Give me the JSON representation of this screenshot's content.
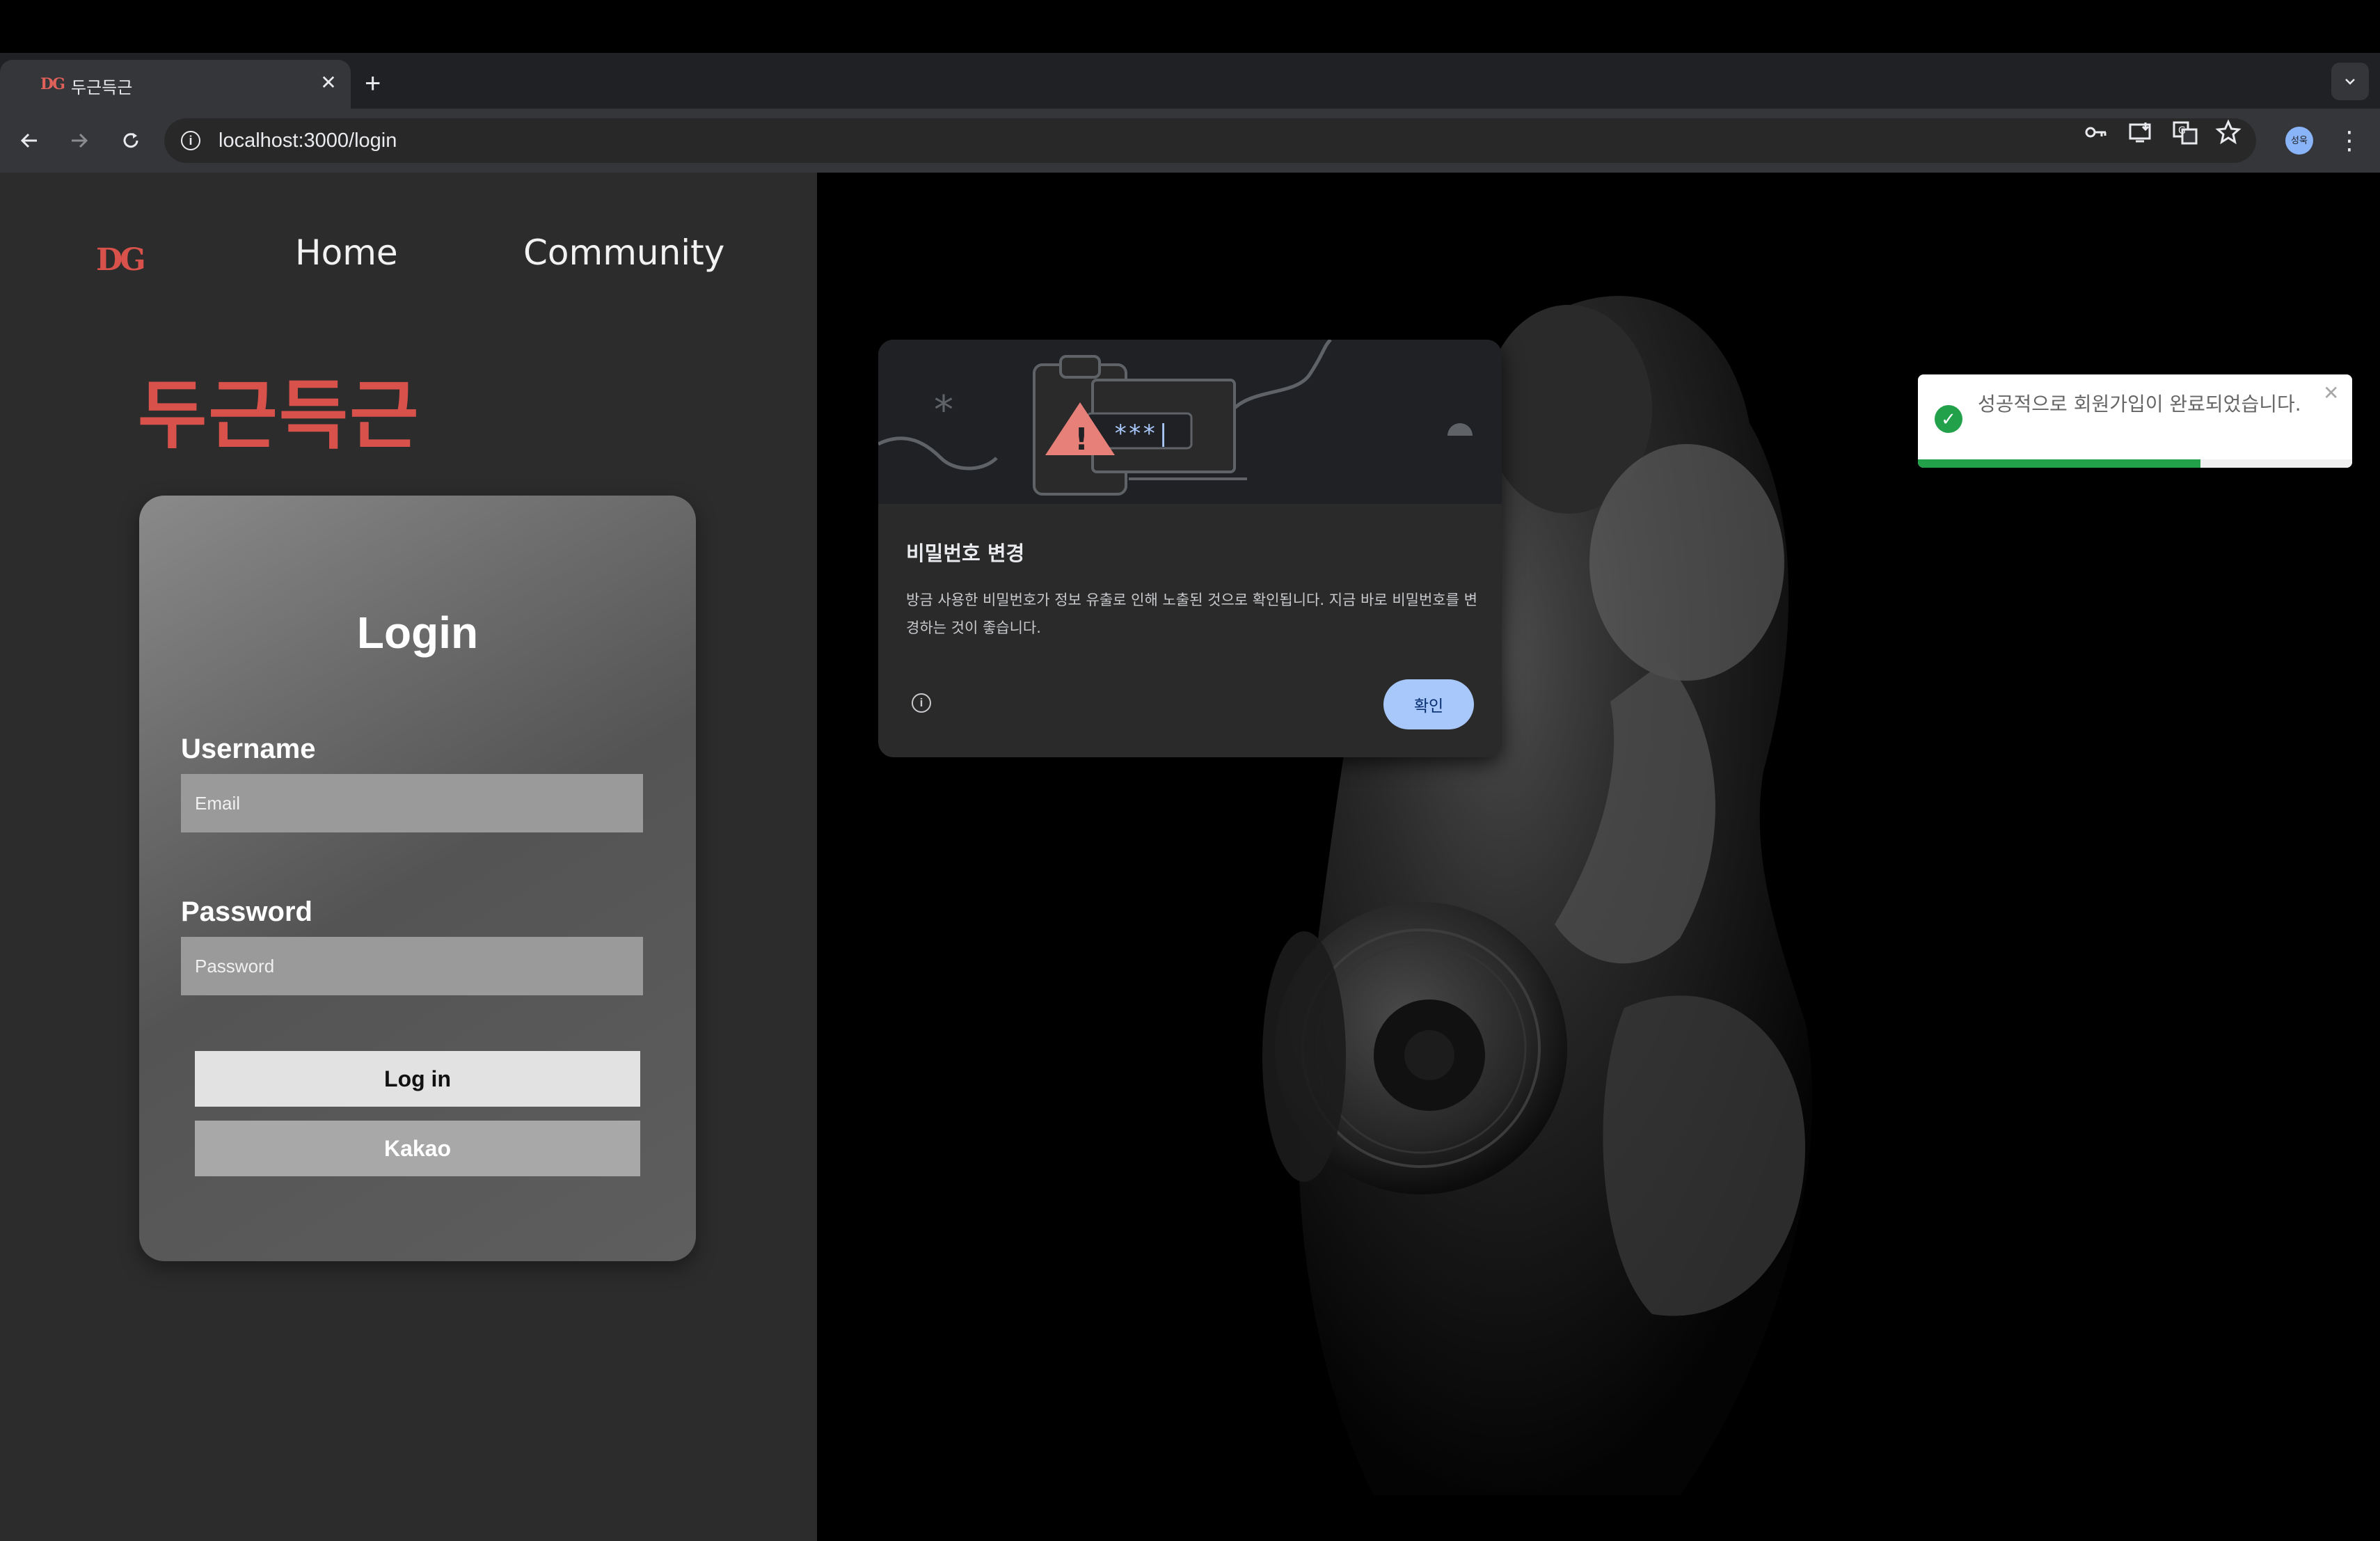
{
  "browser": {
    "tab": {
      "favicon_text": "DG",
      "title": "두근득근",
      "close_glyph": "✕"
    },
    "new_tab_glyph": "+",
    "tab_search_glyph": "⌄",
    "url": "localhost:3000/login",
    "profile_text": "성욱",
    "icons": [
      "back-icon",
      "forward-icon",
      "reload-icon",
      "site-info-icon",
      "password-key-icon",
      "install-app-icon",
      "translate-icon",
      "bookmark-star-icon",
      "profile-avatar",
      "menu-dots-icon"
    ]
  },
  "site": {
    "logo": "DG",
    "nav": {
      "home": "Home",
      "community": "Community"
    },
    "brand_title": "두근득근",
    "brand_color": "#d8524b"
  },
  "login_form": {
    "title": "Login",
    "username_label": "Username",
    "username_placeholder": "Email",
    "password_label": "Password",
    "password_placeholder": "Password",
    "login_button": "Log in",
    "kakao_button": "Kakao"
  },
  "password_popup": {
    "title": "비밀번호 변경",
    "body": "방금 사용한 비밀번호가 정보 유출로 인해 노출된 것으로 확인됩니다. 지금 바로 비밀번호를 변경하는 것이 좋습니다.",
    "ok_button": "확인",
    "art_password_text": "***|",
    "accent_color": "#a8c7fa",
    "warning_color": "#e8807a"
  },
  "toast": {
    "message": "성공적으로 회원가입이 완료되었습니다.",
    "close_glyph": "✕",
    "progress": 0.65,
    "color": "#22a04a"
  }
}
